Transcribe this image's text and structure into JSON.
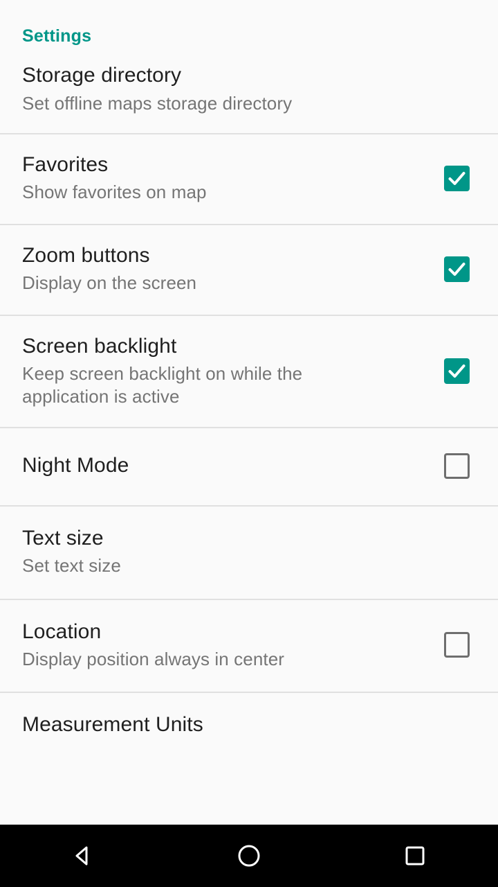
{
  "header": {
    "title": "Settings",
    "accent_color": "#009688"
  },
  "theme": {
    "background": "#fafafa",
    "title_color": "#1f1f1f",
    "subtitle_color": "#757575",
    "divider_color": "#e0e0e0",
    "checkbox_on_color": "#009688",
    "checkbox_off_border": "#6e6e6e",
    "navbar_background": "#000000",
    "navbar_icon_color": "#ffffff"
  },
  "settings": {
    "items": [
      {
        "title": "Storage directory",
        "subtitle": "Set offline maps storage directory",
        "has_checkbox": false,
        "checked": null
      },
      {
        "title": "Favorites",
        "subtitle": "Show favorites on map",
        "has_checkbox": true,
        "checked": true
      },
      {
        "title": "Zoom buttons",
        "subtitle": "Display on the screen",
        "has_checkbox": true,
        "checked": true
      },
      {
        "title": "Screen backlight",
        "subtitle": "Keep screen backlight on while the application is active",
        "has_checkbox": true,
        "checked": true
      },
      {
        "title": "Night Mode",
        "subtitle": "",
        "has_checkbox": true,
        "checked": false
      },
      {
        "title": "Text size",
        "subtitle": "Set text size",
        "has_checkbox": false,
        "checked": null
      },
      {
        "title": "Location",
        "subtitle": "Display position always in center",
        "has_checkbox": true,
        "checked": false
      },
      {
        "title": "Measurement Units",
        "subtitle": "",
        "has_checkbox": false,
        "checked": null
      }
    ]
  },
  "navbar": {
    "back_label": "Back",
    "home_label": "Home",
    "recents_label": "Recent apps"
  }
}
